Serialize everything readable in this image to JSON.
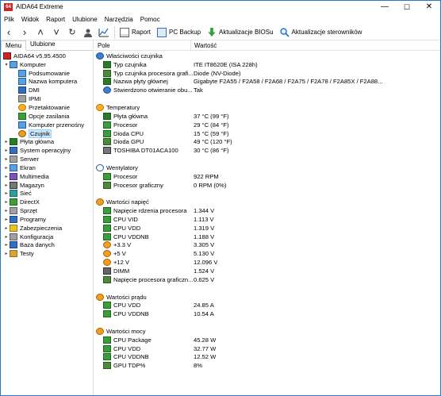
{
  "window": {
    "title": "AIDA64 Extreme",
    "minimize": "—",
    "maximize": "☐",
    "close": "✕"
  },
  "menu": [
    "Plik",
    "Widok",
    "Raport",
    "Ulubione",
    "Narzędzia",
    "Pomoc"
  ],
  "toolbar": {
    "report": "Raport",
    "pcbackup": "PC Backup",
    "bios": "Aktualizacje BIOSu",
    "drivers": "Aktualizacje sterowników"
  },
  "left_tabs": [
    "Menu",
    "Ulubione"
  ],
  "tree": [
    {
      "label": "AIDA64 v5.95.4500",
      "depth": 0,
      "exp": "",
      "icon": "red"
    },
    {
      "label": "Komputer",
      "depth": 1,
      "exp": "▾",
      "icon": "mon"
    },
    {
      "label": "Podsumowanie",
      "depth": 2,
      "exp": "",
      "icon": "mon"
    },
    {
      "label": "Nazwa komputera",
      "depth": 2,
      "exp": "",
      "icon": "mon"
    },
    {
      "label": "DMI",
      "depth": 2,
      "exp": "",
      "icon": "blue"
    },
    {
      "label": "IPMI",
      "depth": 2,
      "exp": "",
      "icon": "gray"
    },
    {
      "label": "Przetaktowanie",
      "depth": 2,
      "exp": "",
      "icon": "orange-c"
    },
    {
      "label": "Opcje zasilania",
      "depth": 2,
      "exp": "",
      "icon": "green"
    },
    {
      "label": "Komputer przenośny",
      "depth": 2,
      "exp": "",
      "icon": "mon"
    },
    {
      "label": "Czujnik",
      "depth": 2,
      "exp": "",
      "icon": "clock",
      "selected": true
    },
    {
      "label": "Płyta główna",
      "depth": 1,
      "exp": "▸",
      "icon": "chip"
    },
    {
      "label": "System operacyjny",
      "depth": 1,
      "exp": "▸",
      "icon": "blue"
    },
    {
      "label": "Serwer",
      "depth": 1,
      "exp": "▸",
      "icon": "gray"
    },
    {
      "label": "Ekran",
      "depth": 1,
      "exp": "▸",
      "icon": "mon"
    },
    {
      "label": "Multimedia",
      "depth": 1,
      "exp": "▸",
      "icon": "purple"
    },
    {
      "label": "Magazyn",
      "depth": 1,
      "exp": "▸",
      "icon": "disk"
    },
    {
      "label": "Sieć",
      "depth": 1,
      "exp": "▸",
      "icon": "teal"
    },
    {
      "label": "DirectX",
      "depth": 1,
      "exp": "▸",
      "icon": "green"
    },
    {
      "label": "Sprzęt",
      "depth": 1,
      "exp": "▸",
      "icon": "gray"
    },
    {
      "label": "Programy",
      "depth": 1,
      "exp": "▸",
      "icon": "blue"
    },
    {
      "label": "Zabezpieczenia",
      "depth": 1,
      "exp": "▸",
      "icon": "yellow"
    },
    {
      "label": "Konfiguracja",
      "depth": 1,
      "exp": "▸",
      "icon": "gray"
    },
    {
      "label": "Baza danych",
      "depth": 1,
      "exp": "▸",
      "icon": "blue"
    },
    {
      "label": "Testy",
      "depth": 1,
      "exp": "▸",
      "icon": "folder"
    }
  ],
  "columns": {
    "field": "Pole",
    "value": "Wartość"
  },
  "rows": [
    {
      "type": "grp",
      "label": "Właściwości czujnika",
      "icon": "info"
    },
    {
      "type": "item",
      "label": "Typ czujnika",
      "value": "ITE IT8620E  (ISA 228h)",
      "icon": "chip"
    },
    {
      "type": "item",
      "label": "Typ czujnika procesora grafi...",
      "value": "Diode  (NV-Diode)",
      "icon": "gpu"
    },
    {
      "type": "item",
      "label": "Nazwa płyty głównej",
      "value": "Gigabyte F2A55 / F2A58 / F2A68 / F2A75 / F2A78 / F2A85X / F2A88...",
      "icon": "chip"
    },
    {
      "type": "item",
      "label": "Stwierdzono otwieranie obu...",
      "value": "Tak",
      "icon": "info"
    },
    {
      "type": "gap"
    },
    {
      "type": "grp",
      "label": "Temperatury",
      "icon": "orange-c"
    },
    {
      "type": "item",
      "label": "Płyta główna",
      "value": "37 °C  (99 °F)",
      "icon": "chip"
    },
    {
      "type": "item",
      "label": "Procesor",
      "value": "29 °C  (84 °F)",
      "icon": "cpu"
    },
    {
      "type": "item",
      "label": "Dioda CPU",
      "value": "15 °C  (59 °F)",
      "icon": "cpu"
    },
    {
      "type": "item",
      "label": "Dioda GPU",
      "value": "49 °C  (120 °F)",
      "icon": "gpu"
    },
    {
      "type": "item",
      "label": "TOSHIBA DT01ACA100",
      "value": "30 °C  (86 °F)",
      "icon": "disk"
    },
    {
      "type": "gap"
    },
    {
      "type": "grp",
      "label": "Wentylatory",
      "icon": "fan"
    },
    {
      "type": "item",
      "label": "Procesor",
      "value": "922 RPM",
      "icon": "cpu"
    },
    {
      "type": "item",
      "label": "Procesor graficzny",
      "value": "0 RPM  (0%)",
      "icon": "gpu"
    },
    {
      "type": "gap"
    },
    {
      "type": "grp",
      "label": "Wartości napięć",
      "icon": "bolt"
    },
    {
      "type": "item",
      "label": "Napięcie rdzenia procesora",
      "value": "1.344 V",
      "icon": "cpu"
    },
    {
      "type": "item",
      "label": "CPU VID",
      "value": "1.113 V",
      "icon": "cpu"
    },
    {
      "type": "item",
      "label": "CPU VDD",
      "value": "1.319 V",
      "icon": "cpu"
    },
    {
      "type": "item",
      "label": "CPU VDDNB",
      "value": "1.188 V",
      "icon": "cpu"
    },
    {
      "type": "item",
      "label": "+3.3 V",
      "value": "3.305 V",
      "icon": "bolt"
    },
    {
      "type": "item",
      "label": "+5 V",
      "value": "5.130 V",
      "icon": "bolt"
    },
    {
      "type": "item",
      "label": "+12 V",
      "value": "12.096 V",
      "icon": "bolt"
    },
    {
      "type": "item",
      "label": "DIMM",
      "value": "1.524 V",
      "icon": "chip-gray"
    },
    {
      "type": "item",
      "label": "Napięcie procesora graficzn...",
      "value": "0.625 V",
      "icon": "gpu"
    },
    {
      "type": "gap"
    },
    {
      "type": "grp",
      "label": "Wartości prądu",
      "icon": "bolt"
    },
    {
      "type": "item",
      "label": "CPU VDD",
      "value": "24.85 A",
      "icon": "cpu"
    },
    {
      "type": "item",
      "label": "CPU VDDNB",
      "value": "10.54 A",
      "icon": "cpu"
    },
    {
      "type": "gap"
    },
    {
      "type": "grp",
      "label": "Wartości mocy",
      "icon": "bolt"
    },
    {
      "type": "item",
      "label": "CPU Package",
      "value": "45.28 W",
      "icon": "cpu"
    },
    {
      "type": "item",
      "label": "CPU VDD",
      "value": "32.77 W",
      "icon": "cpu"
    },
    {
      "type": "item",
      "label": "CPU VDDNB",
      "value": "12.52 W",
      "icon": "cpu"
    },
    {
      "type": "item",
      "label": "GPU TDP%",
      "value": "8%",
      "icon": "gpu"
    }
  ]
}
